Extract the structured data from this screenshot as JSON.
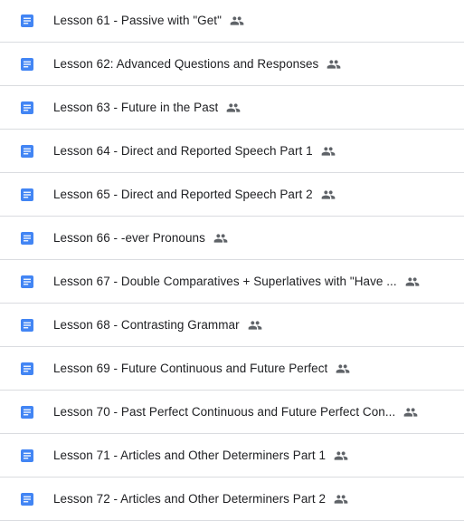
{
  "colors": {
    "doc_icon": "#4285f4",
    "doc_icon_lines": "#ffffff",
    "shared_icon": "#5f6368",
    "divider": "#dadce0",
    "text": "#202124"
  },
  "icons": {
    "doc": "google-docs-icon",
    "shared": "people-icon"
  },
  "files": [
    {
      "name": "Lesson 61 - Passive with \"Get\"",
      "shared": true
    },
    {
      "name": "Lesson 62: Advanced Questions and Responses",
      "shared": true
    },
    {
      "name": "Lesson 63 - Future in the Past",
      "shared": true
    },
    {
      "name": "Lesson 64 - Direct and Reported Speech Part 1",
      "shared": true
    },
    {
      "name": "Lesson 65 - Direct and Reported Speech Part 2",
      "shared": true
    },
    {
      "name": "Lesson 66 - -ever Pronouns",
      "shared": true
    },
    {
      "name": "Lesson 67 - Double Comparatives + Superlatives with \"Have ...",
      "shared": true
    },
    {
      "name": "Lesson 68 - Contrasting Grammar",
      "shared": true
    },
    {
      "name": "Lesson 69 - Future Continuous and Future Perfect",
      "shared": true
    },
    {
      "name": "Lesson 70 - Past Perfect Continuous and Future Perfect Con...",
      "shared": true
    },
    {
      "name": "Lesson 71 - Articles and Other Determiners Part 1",
      "shared": true
    },
    {
      "name": "Lesson 72 - Articles and Other Determiners Part 2",
      "shared": true
    }
  ]
}
